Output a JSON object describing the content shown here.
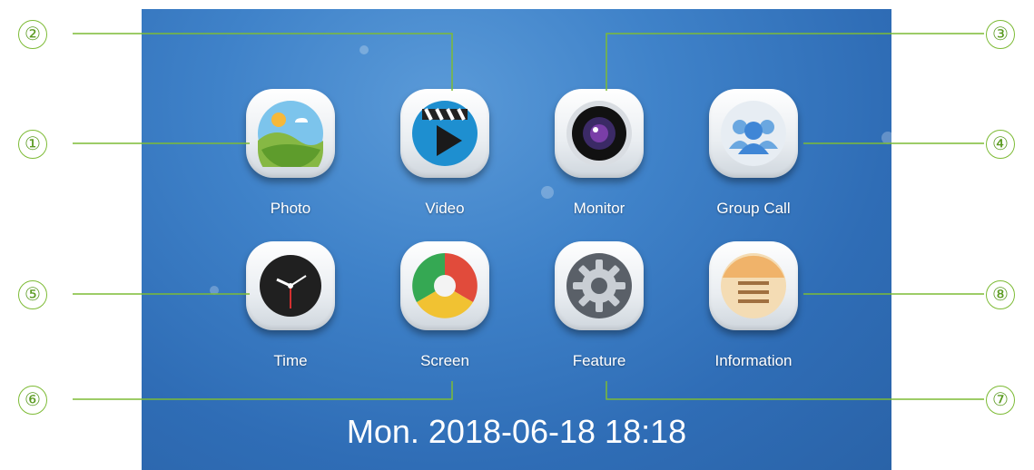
{
  "apps": [
    {
      "label": "Photo",
      "icon": "photo-icon"
    },
    {
      "label": "Video",
      "icon": "video-icon"
    },
    {
      "label": "Monitor",
      "icon": "camera-icon"
    },
    {
      "label": "Group Call",
      "icon": "group-call-icon"
    },
    {
      "label": "Time",
      "icon": "clock-icon"
    },
    {
      "label": "Screen",
      "icon": "color-wheel-icon"
    },
    {
      "label": "Feature",
      "icon": "gear-icon"
    },
    {
      "label": "Information",
      "icon": "info-list-icon"
    }
  ],
  "datetime": "Mon. 2018-06-18 18:18",
  "callouts": [
    "①",
    "②",
    "③",
    "④",
    "⑤",
    "⑥",
    "⑦",
    "⑧"
  ],
  "colors": {
    "background": "#3f82c9",
    "callout": "#7dbb35",
    "label": "#ffffff"
  }
}
